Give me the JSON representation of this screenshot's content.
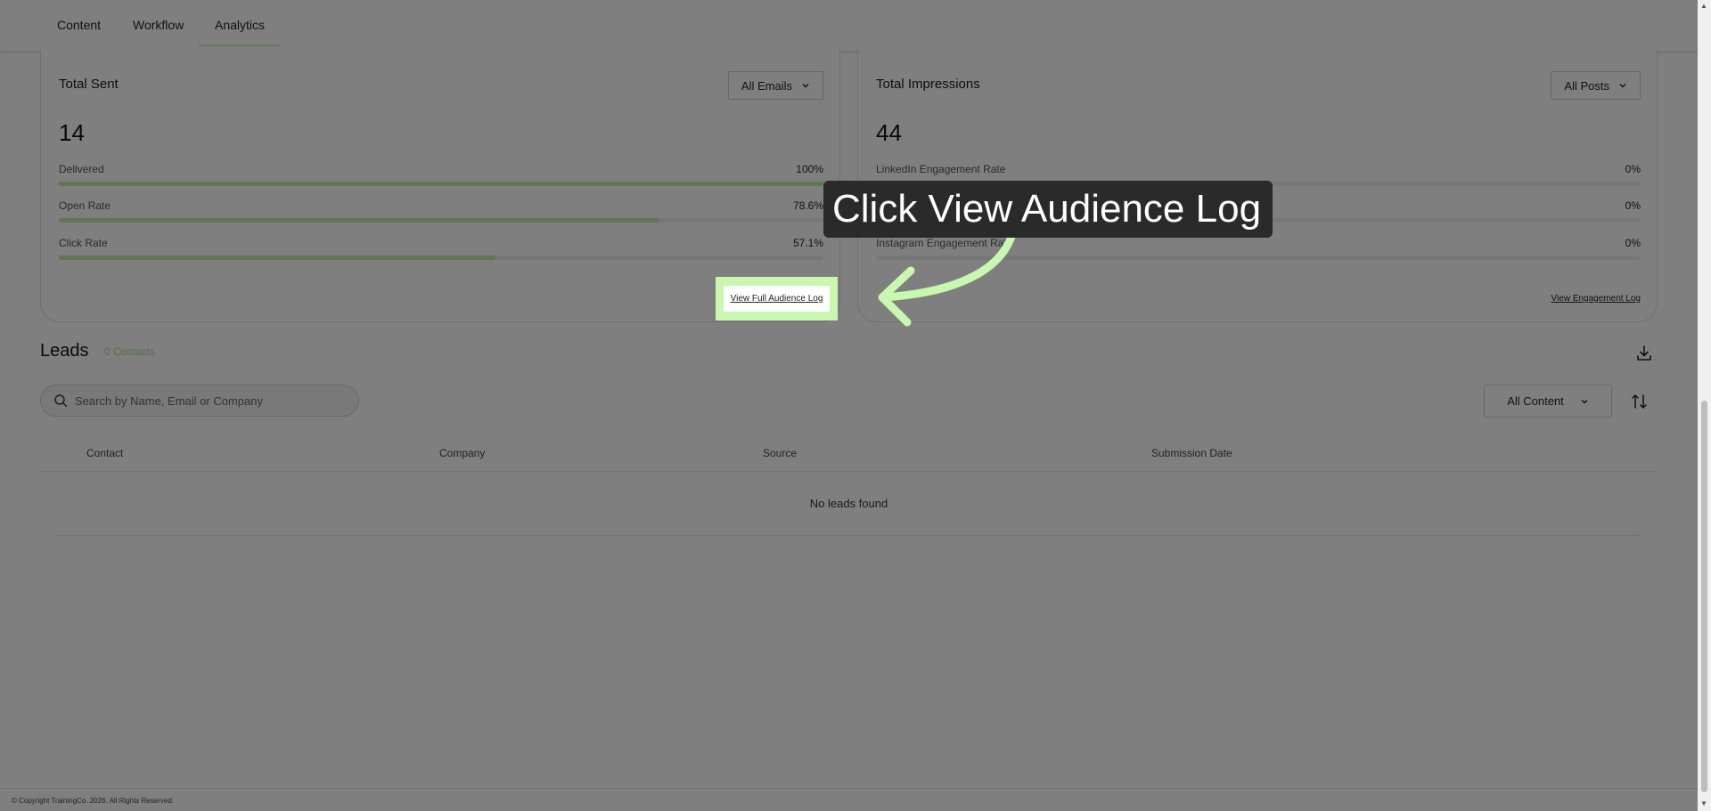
{
  "tabs": [
    {
      "label": "Content"
    },
    {
      "label": "Workflow"
    },
    {
      "label": "Analytics"
    }
  ],
  "email_card": {
    "title": "Total Sent",
    "dropdown": "All Emails",
    "total": "14",
    "metrics": [
      {
        "label": "Delivered",
        "value": "100%",
        "fraction": 1.0
      },
      {
        "label": "Open Rate",
        "value": "78.6%",
        "fraction": 0.786
      },
      {
        "label": "Click Rate",
        "value": "57.1%",
        "fraction": 0.571
      }
    ],
    "link": "View Full Audience Log"
  },
  "social_card": {
    "title": "Total Impressions",
    "dropdown": "All Posts",
    "total": "44",
    "metrics": [
      {
        "label": "LinkedIn Engagement Rate",
        "value": "0%",
        "fraction": 0
      },
      {
        "label": "",
        "value": "0%",
        "fraction": 0
      },
      {
        "label": "Instagram Engagement Rate",
        "value": "0%",
        "fraction": 0
      }
    ],
    "link": "View Engagement Log"
  },
  "leads": {
    "title": "Leads",
    "count": "0 Contacts",
    "search_placeholder": "Search by Name, Email or Company",
    "filter": "All Content",
    "columns": [
      "Contact",
      "Company",
      "Source",
      "Submission Date"
    ],
    "empty_text": "No leads found"
  },
  "footer": {
    "text": "© Copyright TrainingCo. 2026. All Rights Reserved."
  },
  "overlay": {
    "callout": "Click View Audience Log",
    "highlight_color": "#c9f7b0"
  },
  "colors": {
    "accent": "#bfeea8",
    "callout_bg": "#2a2a2a"
  }
}
